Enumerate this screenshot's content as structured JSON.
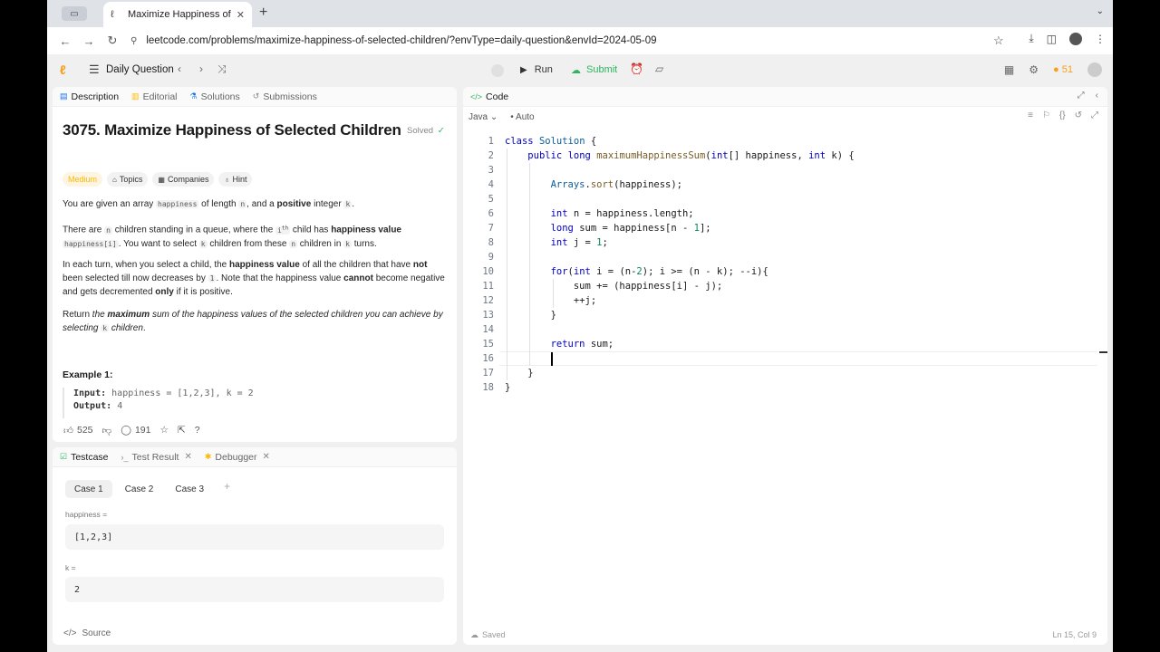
{
  "browser": {
    "tab_title": "Maximize Happiness of Selec",
    "url": "leetcode.com/problems/maximize-happiness-of-selected-children/?envType=daily-question&envId=2024-05-09"
  },
  "header": {
    "daily_label": "Daily Question",
    "run_label": "Run",
    "submit_label": "Submit",
    "streak": "51"
  },
  "description_panel": {
    "tabs": [
      "Description",
      "Editorial",
      "Solutions",
      "Submissions"
    ],
    "title": "3075. Maximize Happiness of Selected Children",
    "solved_label": "Solved",
    "badges": {
      "difficulty": "Medium",
      "topics": "Topics",
      "companies": "Companies",
      "hint": "Hint"
    },
    "p1": {
      "a": "You are given an array ",
      "code1": "happiness",
      "b": " of length ",
      "code2": "n",
      "c": ", and a ",
      "bold": "positive",
      "d": " integer ",
      "code3": "k",
      "e": "."
    },
    "p2": {
      "a": "There are ",
      "code1": "n",
      "b": " children standing in a queue, where the ",
      "code2": "i",
      "sup": "th",
      "c": " child has ",
      "bold": "happiness value",
      "code3": "happiness[i]",
      "d": ". You want to select ",
      "code4": "k",
      "e": " children from these ",
      "code5": "n",
      "f": " children in ",
      "code6": "k",
      "g": " turns."
    },
    "p3": {
      "a": "In each turn, when you select a child, the ",
      "bold1": "happiness value",
      "b": " of all the children that have ",
      "bold2": "not",
      "c": " been selected till now decreases by ",
      "code1": "1",
      "d": ". Note that the happiness value ",
      "bold3": "cannot",
      "e": " become negative and gets decremented ",
      "bold4": "only",
      "f": " if it is positive."
    },
    "p4": {
      "a": "Return ",
      "i1": "the ",
      "bold": "maximum",
      "i2": " sum of the happiness values of the selected children you can achieve by selecting ",
      "code1": "k",
      "i3": " children",
      "e": "."
    },
    "example_title": "Example 1:",
    "example_input_label": "Input:",
    "example_input": "happiness = [1,2,3], k = 2",
    "example_output_label": "Output:",
    "example_output": "4",
    "likes": "525",
    "comments": "191"
  },
  "test_panel": {
    "tabs": [
      "Testcase",
      "Test Result",
      "Debugger"
    ],
    "cases": [
      "Case 1",
      "Case 2",
      "Case 3"
    ],
    "add_label": "+",
    "field1_label": "happiness =",
    "field1_value": "[1,2,3]",
    "field2_label": "k =",
    "field2_value": "2",
    "source_label": "Source"
  },
  "code_panel": {
    "title": "Code",
    "language": "Java",
    "mode": "Auto",
    "saved": "Saved",
    "position": "Ln 15, Col 9",
    "lines": [
      "1",
      "2",
      "3",
      "4",
      "5",
      "6",
      "7",
      "8",
      "9",
      "10",
      "11",
      "12",
      "13",
      "14",
      "15",
      "16",
      "17",
      "18"
    ]
  }
}
